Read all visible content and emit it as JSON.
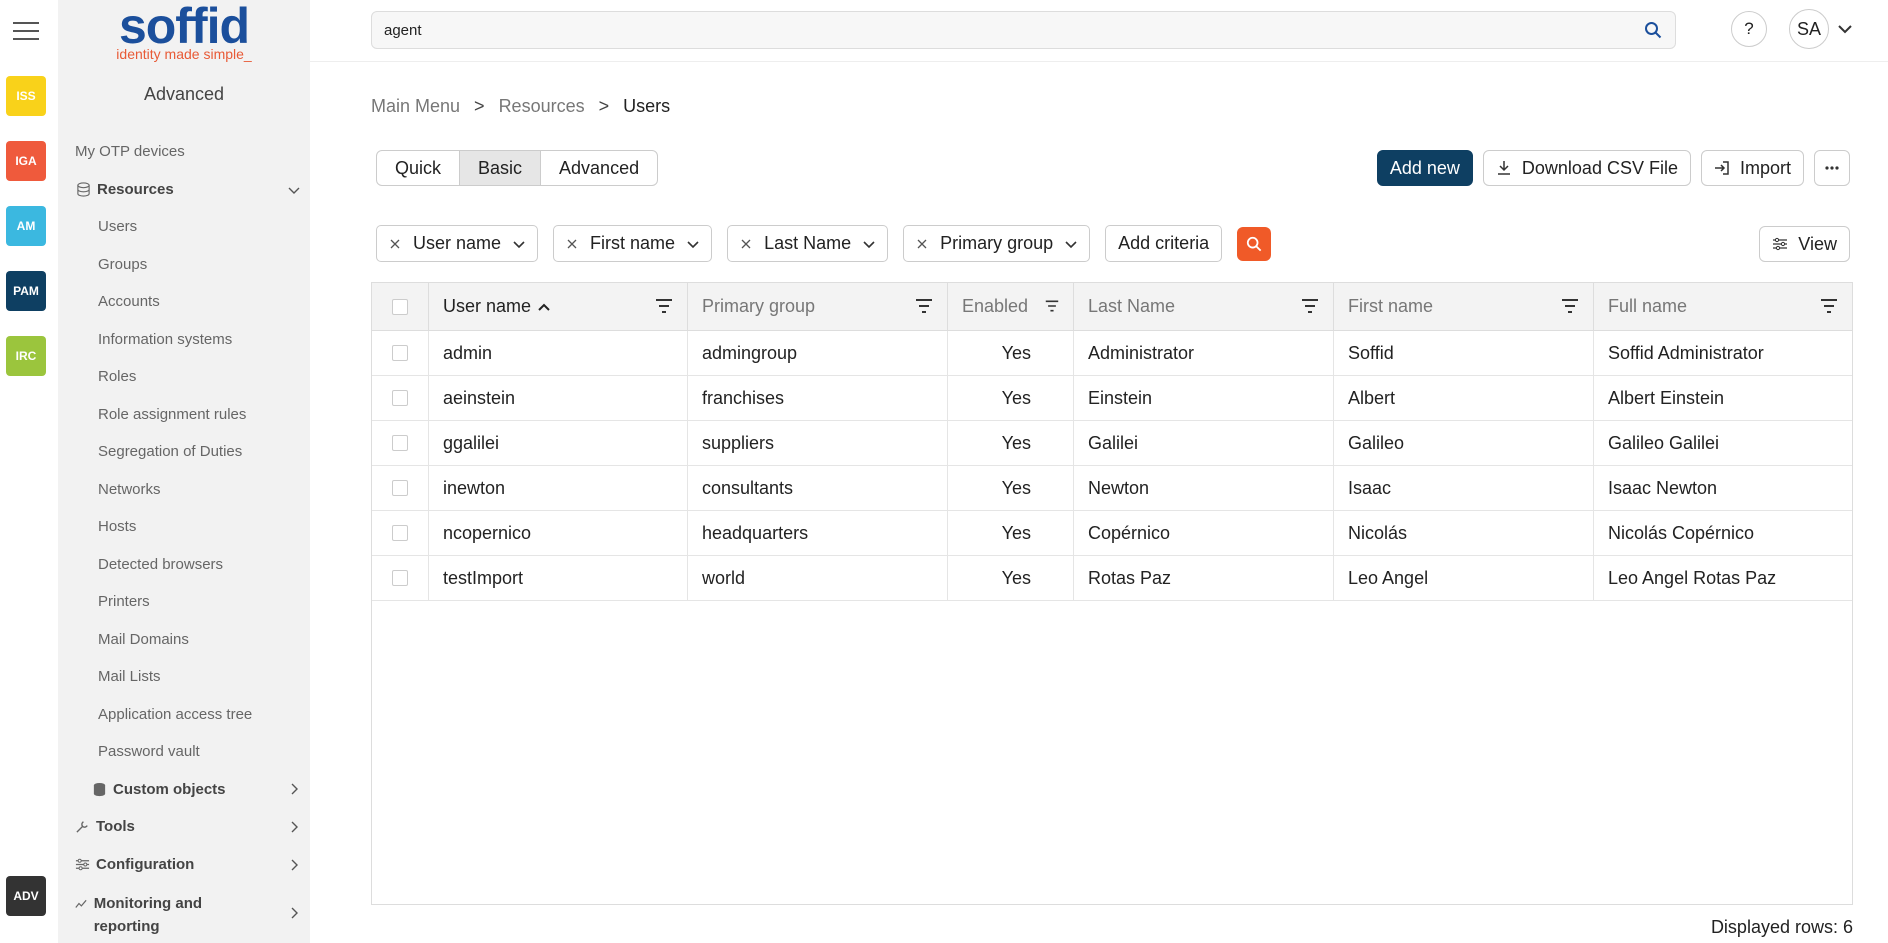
{
  "rail": {
    "items": [
      {
        "label": "ISS",
        "color": "#f9d21a"
      },
      {
        "label": "IGA",
        "color": "#ef5a3c"
      },
      {
        "label": "AM",
        "color": "#3bb8e0"
      },
      {
        "label": "PAM",
        "color": "#0e3f62"
      },
      {
        "label": "IRC",
        "color": "#9bc53d"
      },
      {
        "label": "ADV",
        "color": "#333333"
      }
    ]
  },
  "logo": {
    "word": "soffid",
    "tagline": "identity made simple_"
  },
  "sidebar": {
    "mode": "Advanced",
    "otp": "My OTP devices",
    "resources": {
      "label": "Resources",
      "items": [
        "Users",
        "Groups",
        "Accounts",
        "Information systems",
        "Roles",
        "Role assignment rules",
        "Segregation of Duties",
        "Networks",
        "Hosts",
        "Detected browsers",
        "Printers",
        "Mail Domains",
        "Mail Lists",
        "Application access tree",
        "Password vault"
      ]
    },
    "custom_objects": "Custom objects",
    "tools": "Tools",
    "configuration": "Configuration",
    "monitoring": "Monitoring and reporting"
  },
  "search": {
    "value": "agent"
  },
  "header": {
    "help": "?",
    "avatar": "SA"
  },
  "breadcrumb": {
    "main": "Main Menu",
    "sep": ">",
    "resources": "Resources",
    "current": "Users"
  },
  "modes": [
    "Quick",
    "Basic",
    "Advanced"
  ],
  "actions": {
    "add": "Add new",
    "csv": "Download CSV File",
    "import": "Import"
  },
  "criteria": {
    "items": [
      "User name",
      "First name",
      "Last Name",
      "Primary group"
    ],
    "add": "Add criteria",
    "view": "View"
  },
  "table": {
    "columns": [
      "User name",
      "Primary group",
      "Enabled",
      "Last Name",
      "First name",
      "Full name"
    ],
    "rows": [
      [
        "admin",
        "admingroup",
        "Yes",
        "Administrator",
        "Soffid",
        "Soffid Administrator"
      ],
      [
        "aeinstein",
        "franchises",
        "Yes",
        "Einstein",
        "Albert",
        "Albert Einstein"
      ],
      [
        "ggalilei",
        "suppliers",
        "Yes",
        "Galilei",
        "Galileo",
        "Galileo Galilei"
      ],
      [
        "inewton",
        "consultants",
        "Yes",
        "Newton",
        "Isaac",
        "Isaac Newton"
      ],
      [
        "ncopernico",
        "headquarters",
        "Yes",
        "Copérnico",
        "Nicolás",
        "Nicolás Copérnico"
      ],
      [
        "testImport",
        "world",
        "Yes",
        "Rotas Paz",
        "Leo Angel",
        "Leo Angel Rotas Paz"
      ]
    ]
  },
  "footer": {
    "rows": "Displayed rows: 6"
  }
}
